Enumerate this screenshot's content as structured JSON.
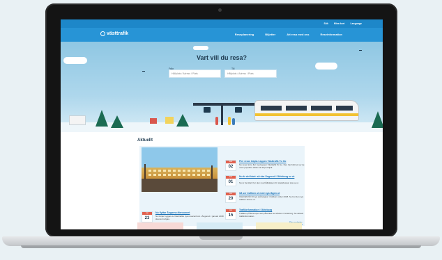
{
  "topbar": {
    "items": [
      "Sök",
      "Mina kort",
      "Language"
    ]
  },
  "nav": {
    "logo": "västtrafik",
    "links": [
      "Reseplanering",
      "Biljetter",
      "Att resa med oss",
      "Reseinformation"
    ]
  },
  "search": {
    "title": "Vart vill du resa?",
    "from_label": "Från",
    "to_label": "Till",
    "from_placeholder": "Hållplats / Adress / Plats",
    "to_placeholder": "Hållplats / Adress / Plats"
  },
  "news": {
    "section_title": "Aktuellt",
    "feature": {
      "month": "Jan",
      "day": "23",
      "title": "Nu flyttar Ängarna återvunnet",
      "text": "Nu börjar bygget av Västtrafiks nya resecentrum i Ängered. I januari 2018 ska det invigas."
    },
    "items": [
      {
        "month": "Feb",
        "day": "02",
        "title": "Fler resor köpta i appen Västtrafik To Go",
        "text": "Nu reser ännu fler med appen Västtrafik To Go. Den har blivit ett av de mest populära sätten att köpa biljett."
      },
      {
        "month": "Feb",
        "day": "01",
        "title": "Nu är det klart: så ska Ängered i Göteborg se ut",
        "text": "Nu är det klart hur den nya hållplatsen för stadsbussar ska se ut."
      },
      {
        "month": "Jan",
        "day": "20",
        "title": "Så ser trafiken ut med nya tågen ut",
        "text": "Västtrafik får till nya spårvagnar i trafiken under 2018. Se hur den nya trafiken ska se ut."
      },
      {
        "month": "Jan",
        "day": "15",
        "title": "Trafikinformation i Göteborg",
        "text": "Trafiken på flera linjer kan påverkas av arbeten i Göteborg. Se aktuell trafikinformation."
      }
    ],
    "more_link": "Fler nyheter"
  }
}
